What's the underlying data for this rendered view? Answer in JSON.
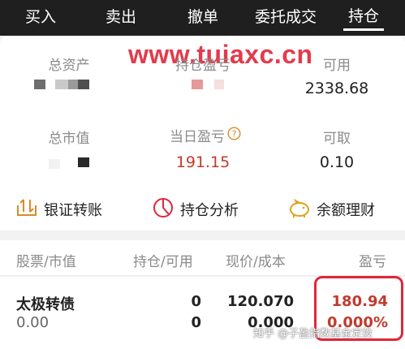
{
  "nav": {
    "tabs": [
      {
        "label": "买入"
      },
      {
        "label": "卖出"
      },
      {
        "label": "撤单"
      },
      {
        "label": "委托成交"
      },
      {
        "label": "持仓"
      }
    ]
  },
  "watermark": "www.tuiaxc.cn",
  "summary": {
    "total_assets_label": "总资产",
    "position_pl_label": "持仓盈亏",
    "available_label": "可用",
    "available_value": "2338.68",
    "market_value_label": "总市值",
    "today_pl_label": "当日盈亏",
    "today_pl_value": "191.15",
    "withdrawable_label": "可取",
    "withdrawable_value": "0.10"
  },
  "actions": {
    "transfer": "银证转账",
    "analysis": "持仓分析",
    "wealth": "余额理财"
  },
  "table": {
    "headers": {
      "stock": "股票/市值",
      "position": "持仓/可用",
      "price": "现价/成本",
      "pl": "盈亏"
    },
    "rows": [
      {
        "name": "太极转债",
        "market_value": "0.00",
        "position": "0",
        "available": "0",
        "price": "120.070",
        "cost": "0.000",
        "pl": "180.94",
        "pl_pct": "0.000%"
      }
    ]
  },
  "zhihu_credit": "知乎 @子盈指数基金定投",
  "colors": {
    "nav_bg": "#1f1f1f",
    "profit_red": "#c23a2e",
    "highlight": "#e0263a"
  }
}
